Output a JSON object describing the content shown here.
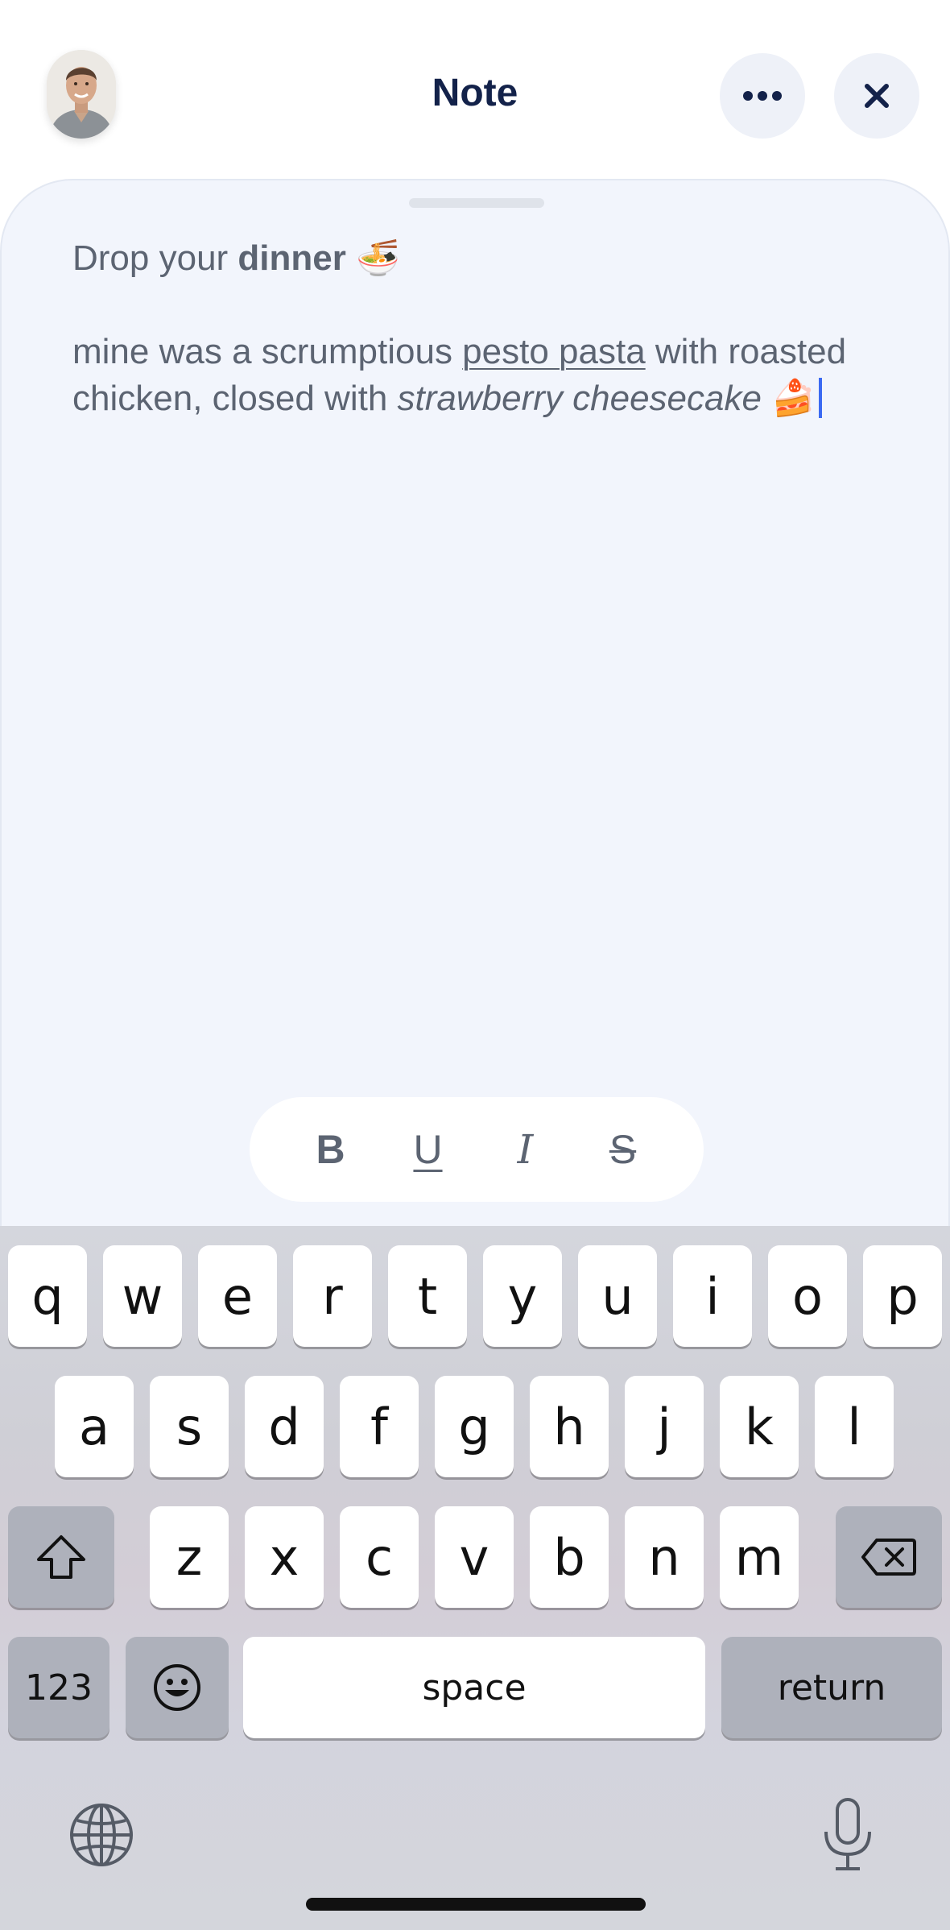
{
  "header": {
    "title": "Note",
    "more_icon": "more-horizontal-icon",
    "close_icon": "close-icon"
  },
  "note": {
    "line1_prefix": "Drop your ",
    "line1_bold": "dinner",
    "line1_emoji": "🍜",
    "body_part1": "mine was a scrumptious ",
    "body_underlined": "pesto pasta",
    "body_part2": " with roasted chicken, closed with ",
    "body_italic": "strawberry cheesecake",
    "body_emoji": "🍰"
  },
  "format_toolbar": {
    "bold": "B",
    "underline": "U",
    "italic": "I",
    "strike": "S"
  },
  "keyboard": {
    "row1": [
      "q",
      "w",
      "e",
      "r",
      "t",
      "y",
      "u",
      "i",
      "o",
      "p"
    ],
    "row2": [
      "a",
      "s",
      "d",
      "f",
      "g",
      "h",
      "j",
      "k",
      "l"
    ],
    "row3": [
      "z",
      "x",
      "c",
      "v",
      "b",
      "n",
      "m"
    ],
    "numbers_label": "123",
    "space_label": "space",
    "return_label": "return",
    "shift_icon": "shift-icon",
    "delete_icon": "backspace-icon",
    "emoji_icon": "emoji-icon",
    "globe_icon": "globe-icon",
    "mic_icon": "microphone-icon"
  },
  "colors": {
    "title": "#13224a",
    "sheet_bg": "#f2f5fc",
    "caret": "#3b6af2"
  }
}
